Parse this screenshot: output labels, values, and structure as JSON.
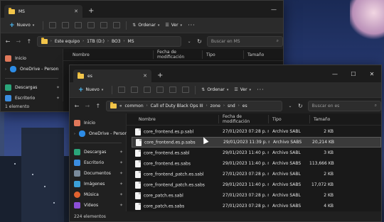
{
  "back_window": {
    "tab_title": "MS",
    "cmd": {
      "new_label": "Nuevo",
      "sort_label": "Ordenar",
      "view_label": "Ver",
      "more": "···"
    },
    "breadcrumb": [
      "Este equipo",
      "1TB (D:)",
      "BO3",
      "MS"
    ],
    "search_placeholder": "Buscar en MS",
    "columns": [
      "Nombre",
      "Fecha de modificación",
      "Tipo",
      "Tamaño"
    ],
    "sidebar": [
      {
        "label": "Inicio",
        "icon": "home-icon"
      },
      {
        "label": "OneDrive - Person",
        "icon": "onedrive-icon"
      },
      {
        "label": "Descargas",
        "icon": "downloads-icon"
      },
      {
        "label": "Escritorio",
        "icon": "desktop-icon"
      }
    ],
    "status": "1 elemento"
  },
  "front_window": {
    "tab_title": "es",
    "cmd": {
      "new_label": "Nuevo",
      "sort_label": "Ordenar",
      "view_label": "Ver",
      "more": "···"
    },
    "breadcrumb": [
      "common",
      "Call of Duty Black Ops III",
      "zone",
      "snd",
      "es"
    ],
    "breadcrumb_prefix": "«",
    "search_placeholder": "Buscar en es",
    "columns": [
      "Nombre",
      "Fecha de modificación",
      "Tipo",
      "Tamaño"
    ],
    "sidebar": [
      {
        "label": "Inicio",
        "icon": "home-icon",
        "pinned": false
      },
      {
        "label": "OneDrive - Person",
        "icon": "onedrive-icon",
        "pinned": false
      },
      {
        "label": "Descargas",
        "icon": "downloads-icon",
        "pinned": true
      },
      {
        "label": "Escritorio",
        "icon": "desktop-icon",
        "pinned": true
      },
      {
        "label": "Documentos",
        "icon": "documents-icon",
        "pinned": true
      },
      {
        "label": "Imágenes",
        "icon": "pictures-icon",
        "pinned": true
      },
      {
        "label": "Música",
        "icon": "music-icon",
        "pinned": true
      },
      {
        "label": "Vídeos",
        "icon": "videos-icon",
        "pinned": true
      }
    ],
    "files": [
      {
        "name": "core_frontend.es.p.sabl",
        "date": "27/01/2023 07:28 p. m.",
        "type": "Archivo SABL",
        "size": "2 KB",
        "selected": false
      },
      {
        "name": "core_frontend.es.p.sabs",
        "date": "29/01/2023 11:39 p. m.",
        "type": "Archivo SABS",
        "size": "20,214 KB",
        "selected": true
      },
      {
        "name": "core_frontend.es.sabl",
        "date": "29/01/2023 11:40 p. m.",
        "type": "Archivo SABL",
        "size": "3 KB",
        "selected": false
      },
      {
        "name": "core_frontend.es.sabs",
        "date": "29/01/2023 11:40 p. m.",
        "type": "Archivo SABS",
        "size": "113,666 KB",
        "selected": false
      },
      {
        "name": "core_frontend_patch.es.sabl",
        "date": "27/01/2023 07:28 p. m.",
        "type": "Archivo SABL",
        "size": "2 KB",
        "selected": false
      },
      {
        "name": "core_frontend_patch.es.sabs",
        "date": "29/01/2023 11:40 p. m.",
        "type": "Archivo SABS",
        "size": "17,072 KB",
        "selected": false
      },
      {
        "name": "core_patch.es.sabl",
        "date": "27/01/2023 07:28 p. m.",
        "type": "Archivo SABL",
        "size": "2 KB",
        "selected": false
      },
      {
        "name": "core_patch.es.sabs",
        "date": "27/01/2023 07:28 p. m.",
        "type": "Archivo SABS",
        "size": "4 KB",
        "selected": false
      }
    ],
    "status": "224 elementos"
  },
  "colors": {
    "accent": "#4cc2ff",
    "folder": "#f2c54a",
    "window_bg": "#202020",
    "list_bg": "#191919"
  }
}
